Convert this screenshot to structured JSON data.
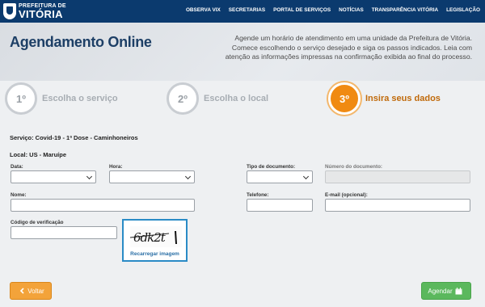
{
  "header": {
    "logo_small": "PREFEITURA DE",
    "logo_big": "VITÓRIA",
    "nav": [
      "OBSERVA VIX",
      "SECRETARIAS",
      "PORTAL DE SERVIÇOS",
      "NOTÍCIAS",
      "TRANSPARÊNCIA VITÓRIA",
      "LEGISLAÇÃO"
    ]
  },
  "hero": {
    "title": "Agendamento Online",
    "description": "Agende um horário de atendimento em uma unidade da Prefeitura de Vitória. Comece escolhendo o serviço desejado e siga os passos indicados. Leia com atenção as informações impressas na confirmação exibida ao final do processo."
  },
  "steps": [
    {
      "number": "1º",
      "label": "Escolha o serviço",
      "active": false
    },
    {
      "number": "2º",
      "label": "Escolha o local",
      "active": false
    },
    {
      "number": "3º",
      "label": "Insira seus dados",
      "active": true
    }
  ],
  "service": "Serviço: Covid-19 - 1ª Dose - Caminhoneiros",
  "location": "Local: US - Maruípe",
  "form": {
    "date_label": "Data:",
    "hour_label": "Hora:",
    "doc_type_label": "Tipo de documento:",
    "doc_number_label": "Número do documento:",
    "name_label": "Nome:",
    "phone_label": "Telefone:",
    "email_label": "E-mail (opcional):",
    "verification_label": "Código de verificação"
  },
  "captcha": {
    "text": "6dk2t",
    "reload_label": "Recarregar imagem"
  },
  "buttons": {
    "back": "Voltar",
    "schedule": "Agendar"
  },
  "colors": {
    "header": "#0b3a6e",
    "title": "#1d3f66",
    "active_step": "#f08a12",
    "back_button": "#f3a33a",
    "schedule_button": "#5bb85d",
    "captcha_border": "#2a8bc6"
  }
}
